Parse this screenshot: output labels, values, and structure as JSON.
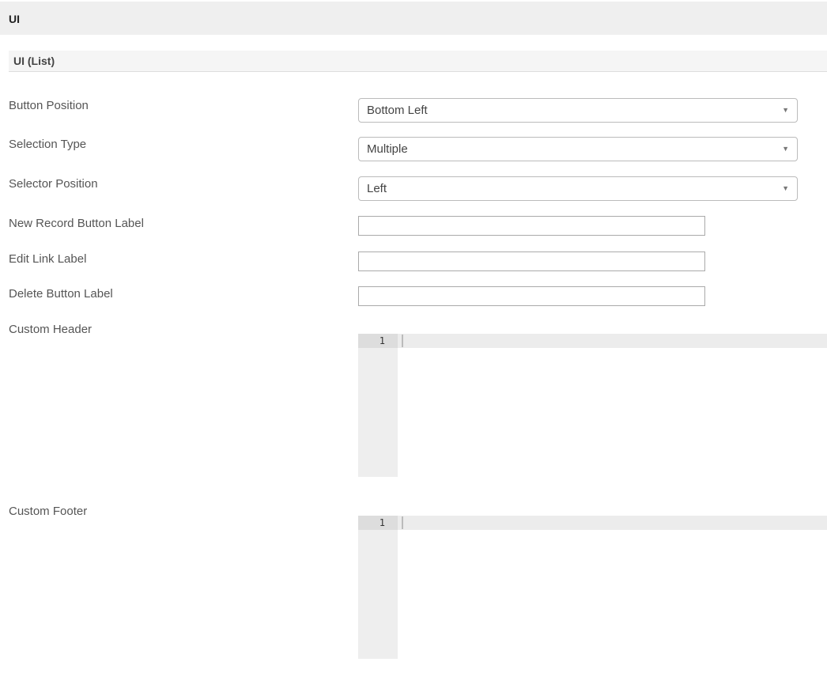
{
  "header": {
    "title": "UI"
  },
  "section": {
    "title": "UI (List)"
  },
  "fields": {
    "button_position": {
      "label": "Button Position",
      "value": "Bottom Left"
    },
    "selection_type": {
      "label": "Selection Type",
      "value": "Multiple"
    },
    "selector_position": {
      "label": "Selector Position",
      "value": "Left"
    },
    "new_record_label": {
      "label": "New Record Button Label",
      "value": ""
    },
    "edit_link_label": {
      "label": "Edit Link Label",
      "value": ""
    },
    "delete_button_label": {
      "label": "Delete Button Label",
      "value": ""
    },
    "custom_header": {
      "label": "Custom Header",
      "line_number": "1"
    },
    "custom_footer": {
      "label": "Custom Footer",
      "line_number": "1"
    }
  },
  "icons": {
    "dropdown": "▼"
  }
}
